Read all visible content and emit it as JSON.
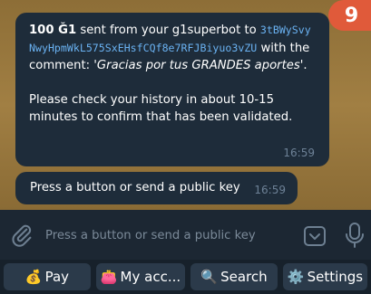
{
  "messages": {
    "main": {
      "amount": "100 Ğ1",
      "text_before_key": " sent from your g1superbot to ",
      "public_key": "3tBWySvyNwyHpmWkL575SxEHsfCQf8e7RFJBiyuo3vZU",
      "text_before_comment": " with the comment: '",
      "comment": "Gracias por tus GRANDES aportes",
      "text_after_comment": "'.",
      "instruction": "Please check your history in about 10-15 minutes to confirm that has been validated.",
      "time": "16:59"
    },
    "prompt": {
      "text": "Press a button or send a public key",
      "time": "16:59"
    }
  },
  "badge": {
    "count": "9",
    "color": "#e05a3a"
  },
  "input": {
    "placeholder": "Press a button or send a public key",
    "attach_icon": "paperclip-icon",
    "keyboard_icon": "keyboard-toggle-icon",
    "mic_icon": "microphone-icon"
  },
  "keyboard": {
    "buttons": [
      {
        "icon": "💰",
        "label": "Pay"
      },
      {
        "icon": "👛",
        "label": "My acc..."
      },
      {
        "icon": "🔍",
        "label": "Search"
      },
      {
        "icon": "⚙️",
        "label": "Settings"
      }
    ]
  },
  "colors": {
    "bubble": "#1e2c3a",
    "link": "#6ab2f2",
    "input_bar": "#1c2733",
    "keyboard_button": "#2b3a4a"
  }
}
